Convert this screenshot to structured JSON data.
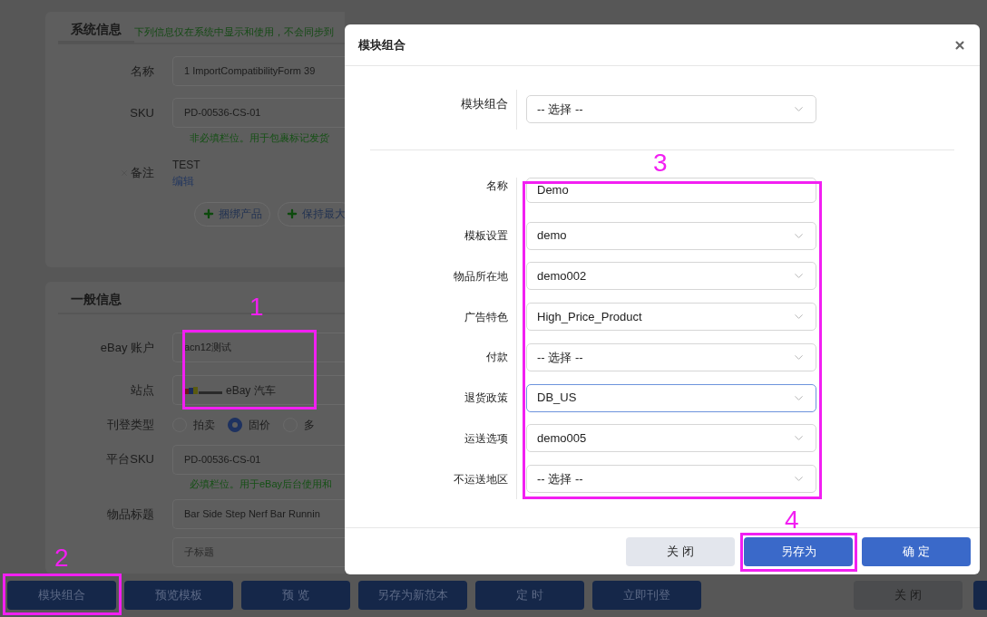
{
  "background": {
    "system_info": {
      "tab": "系统信息",
      "note": "下列信息仅在系统中显示和使用，不会同步到",
      "fields": [
        {
          "label": "名称",
          "value": "1 ImportCompatibilityForm 39"
        },
        {
          "label": "SKU",
          "value": "PD-00536-CS-01",
          "hint": "非必填栏位。用于包裹标记发货"
        }
      ],
      "remark": {
        "label": "备注",
        "value": "TEST",
        "link": "编辑"
      },
      "buttons": [
        "捆绑产品",
        "保持最大"
      ]
    },
    "general_info": {
      "tab": "一般信息",
      "account": {
        "label": "eBay 账户",
        "value": "acn12测试"
      },
      "site": {
        "label": "站点",
        "value": "eBay 汽车"
      },
      "listing_type": {
        "label": "刊登类型",
        "options": [
          {
            "label": "拍卖",
            "selected": false
          },
          {
            "label": "固价",
            "selected": true
          },
          {
            "label": "多",
            "selected": false
          }
        ]
      },
      "platform_sku": {
        "label": "平台SKU",
        "value": "PD-00536-CS-01",
        "hint": "必填栏位。用于eBay后台使用和"
      },
      "item_title": {
        "label": "物品标题",
        "value": "Bar Side Step Nerf Bar Runnin"
      },
      "subtitle": {
        "placeholder": "子标题"
      }
    },
    "bottom_buttons": [
      {
        "label": "模块组合",
        "kind": "primary"
      },
      {
        "label": "预览模板",
        "kind": "primary"
      },
      {
        "label": "预 览",
        "kind": "primary"
      },
      {
        "label": "另存为新范本",
        "kind": "primary"
      },
      {
        "label": "定 时",
        "kind": "primary"
      },
      {
        "label": "立即刊登",
        "kind": "primary"
      },
      {
        "label": "关 闭",
        "kind": "secondary"
      }
    ]
  },
  "dialog": {
    "title": "模块组合",
    "combo": {
      "label": "模块组合",
      "value": "-- 选择 --"
    },
    "fields": [
      {
        "label": "名称",
        "value": "Demo",
        "kind": "input",
        "focused": false
      },
      {
        "label": "模板设置",
        "value": "demo",
        "kind": "select",
        "focused": false
      },
      {
        "label": "物品所在地",
        "value": "demo002",
        "kind": "select",
        "focused": false
      },
      {
        "label": "广告特色",
        "value": "High_Price_Product",
        "kind": "select",
        "focused": false
      },
      {
        "label": "付款",
        "value": "-- 选择 --",
        "kind": "select",
        "focused": false
      },
      {
        "label": "退货政策",
        "value": "DB_US",
        "kind": "select",
        "focused": true
      },
      {
        "label": "运送选项",
        "value": "demo005",
        "kind": "select",
        "focused": false
      },
      {
        "label": "不运送地区",
        "value": "-- 选择 --",
        "kind": "select",
        "focused": false
      }
    ],
    "buttons": [
      {
        "label": "关 闭",
        "kind": "secondary"
      },
      {
        "label": "另存为",
        "kind": "primary"
      },
      {
        "label": "确 定",
        "kind": "primary"
      }
    ]
  },
  "annotations": [
    {
      "label": "1"
    },
    {
      "label": "2"
    },
    {
      "label": "3"
    },
    {
      "label": "4"
    }
  ]
}
